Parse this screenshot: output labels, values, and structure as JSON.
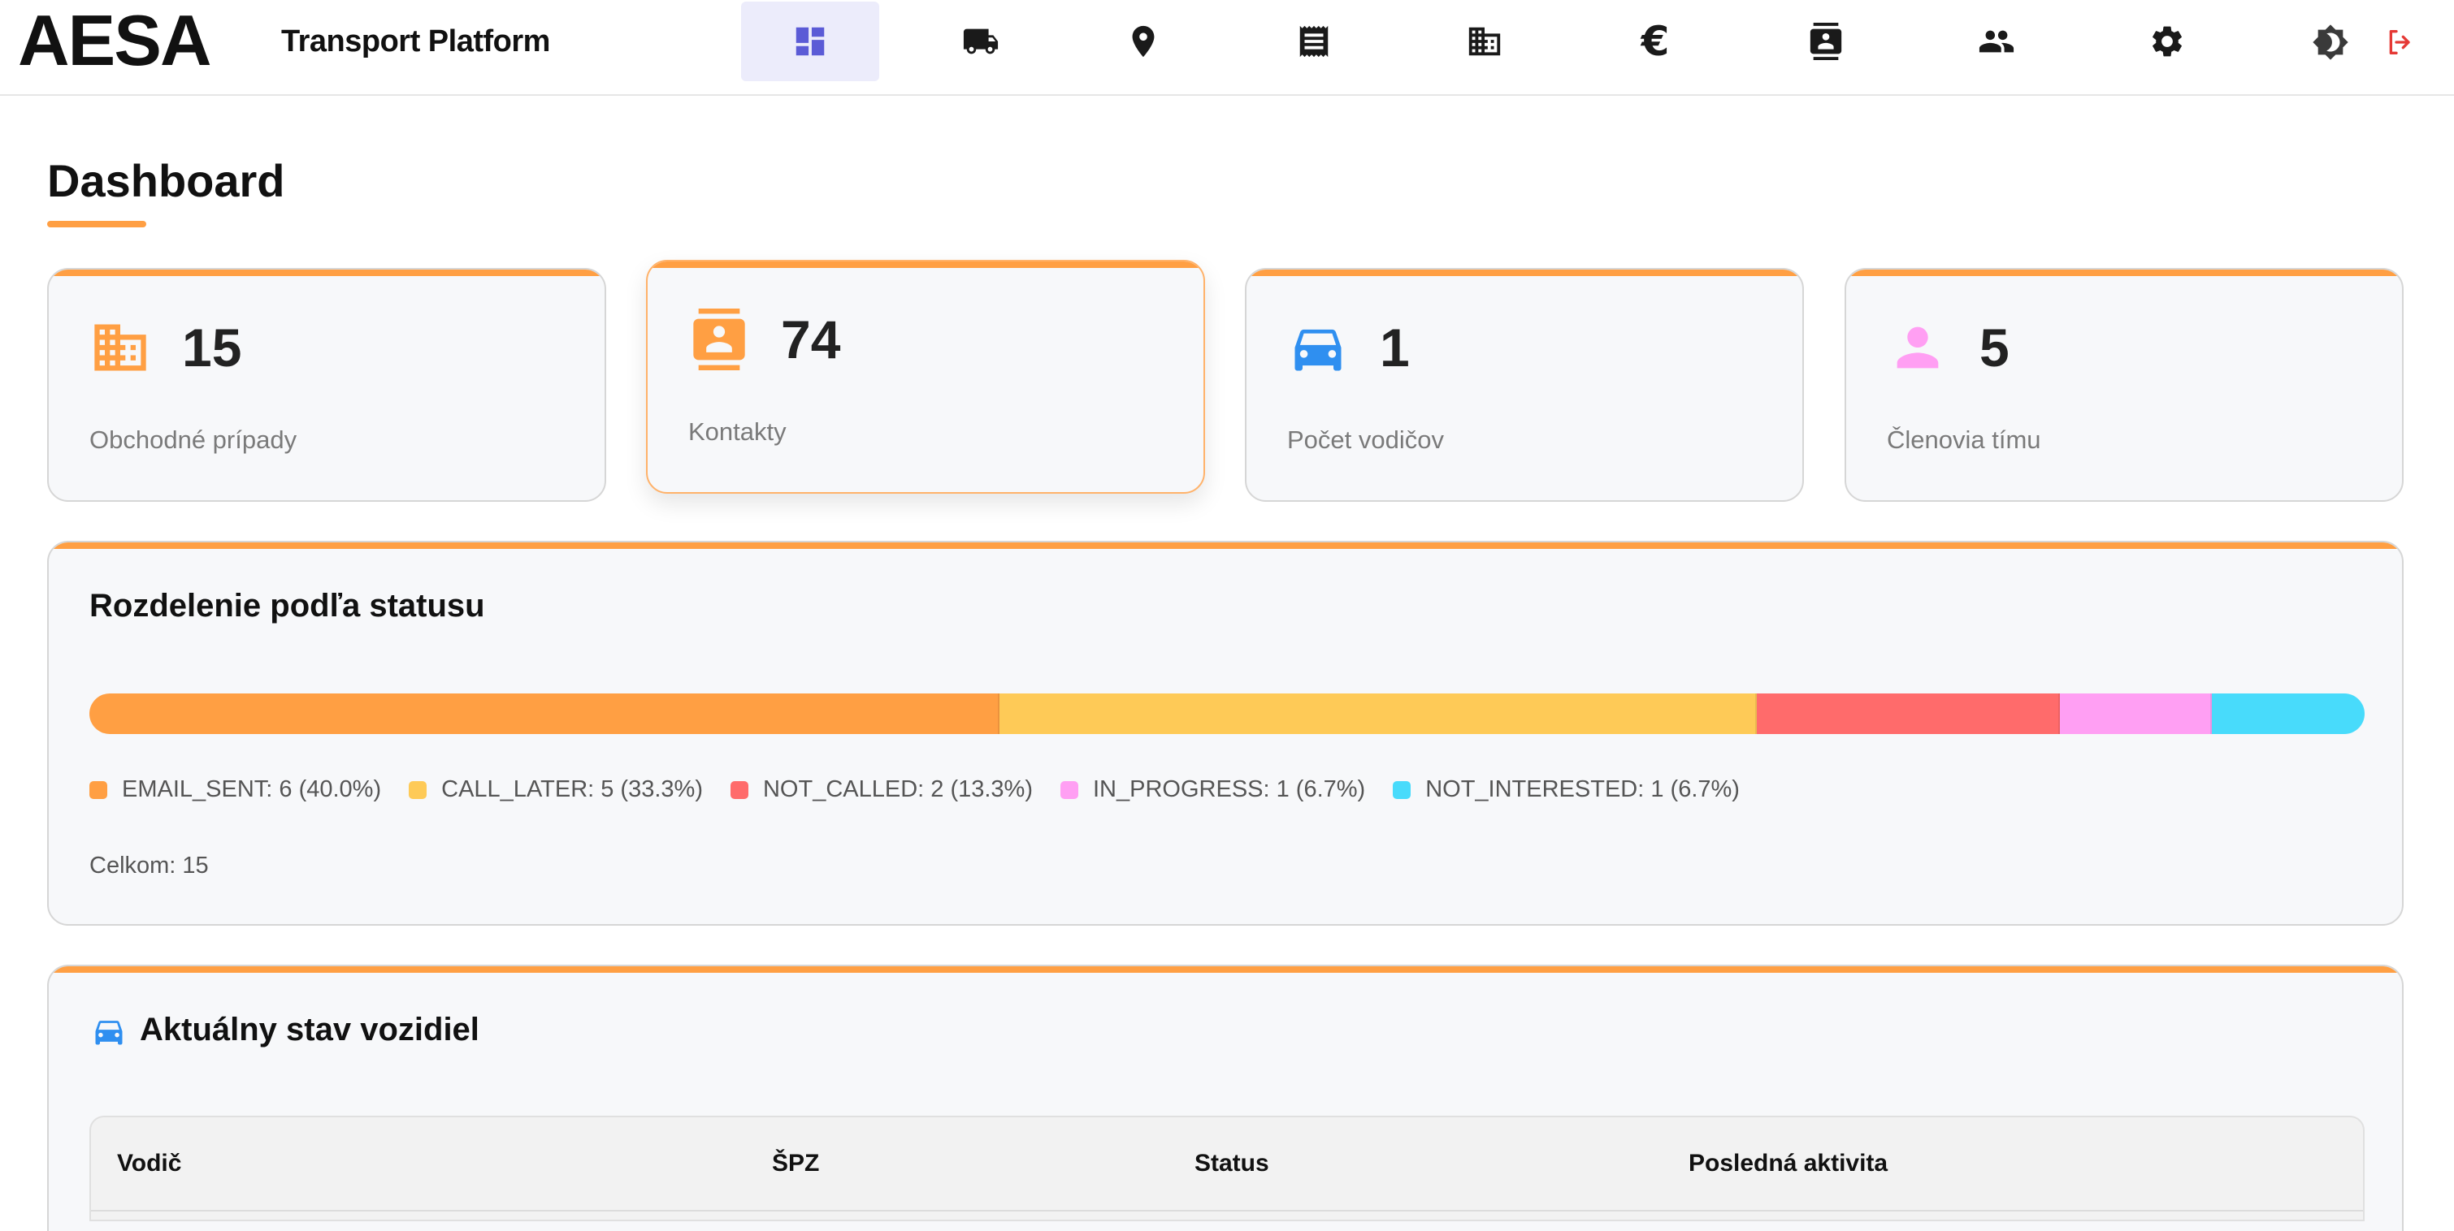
{
  "app": {
    "brand": "AESA",
    "title": "Transport Platform"
  },
  "nav": {
    "items": [
      {
        "name": "dashboard",
        "icon": "dashboard-icon",
        "active": true
      },
      {
        "name": "transport",
        "icon": "truck-icon",
        "active": false
      },
      {
        "name": "locations",
        "icon": "map-pin-icon",
        "active": false
      },
      {
        "name": "receipts",
        "icon": "receipt-icon",
        "active": false
      },
      {
        "name": "companies",
        "icon": "building-icon",
        "active": false
      },
      {
        "name": "finance",
        "icon": "euro-icon",
        "active": false
      },
      {
        "name": "contacts",
        "icon": "contacts-icon",
        "active": false
      },
      {
        "name": "team",
        "icon": "people-icon",
        "active": false
      },
      {
        "name": "settings",
        "icon": "gear-icon",
        "active": false
      }
    ],
    "theme_icon": "theme-toggle-icon",
    "logout_icon": "logout-icon"
  },
  "page": {
    "title": "Dashboard"
  },
  "stats": [
    {
      "value": "15",
      "label": "Obchodné prípady",
      "icon": "building-icon",
      "color": "#ff9f43"
    },
    {
      "value": "74",
      "label": "Kontakty",
      "icon": "contacts-icon",
      "color": "#ff9f43"
    },
    {
      "value": "1",
      "label": "Počet vodičov",
      "icon": "car-icon",
      "color": "#2f8ff0"
    },
    {
      "value": "5",
      "label": "Členovia tímu",
      "icon": "person-icon",
      "color": "#ff9ff3"
    }
  ],
  "status_section": {
    "title": "Rozdelenie podľa statusu",
    "segments": [
      {
        "key": "EMAIL_SENT",
        "count": 6,
        "fraction": 0.4,
        "color": "#ff9f43",
        "label": "EMAIL_SENT: 6 (40.0%)"
      },
      {
        "key": "CALL_LATER",
        "count": 5,
        "fraction": 0.333,
        "color": "#feca57",
        "label": "CALL_LATER: 5 (33.3%)"
      },
      {
        "key": "NOT_CALLED",
        "count": 2,
        "fraction": 0.133,
        "color": "#ff6b6b",
        "label": "NOT_CALLED: 2 (13.3%)"
      },
      {
        "key": "IN_PROGRESS",
        "count": 1,
        "fraction": 0.067,
        "color": "#ff9ff3",
        "label": "IN_PROGRESS: 1 (6.7%)"
      },
      {
        "key": "NOT_INTERESTED",
        "count": 1,
        "fraction": 0.067,
        "color": "#48dbfb",
        "label": "NOT_INTERESTED: 1 (6.7%)"
      }
    ],
    "total": "Celkom: 15"
  },
  "vehicles": {
    "title": "Aktuálny stav vozidiel",
    "icon": "car-icon",
    "columns": [
      "Vodič",
      "ŠPZ",
      "Status",
      "Posledná aktivita"
    ]
  },
  "colors": {
    "accent": "#ff9f43",
    "active_nav_bg": "#ececfb",
    "active_nav_icon": "#6c63ff",
    "logout": "#e53935"
  }
}
